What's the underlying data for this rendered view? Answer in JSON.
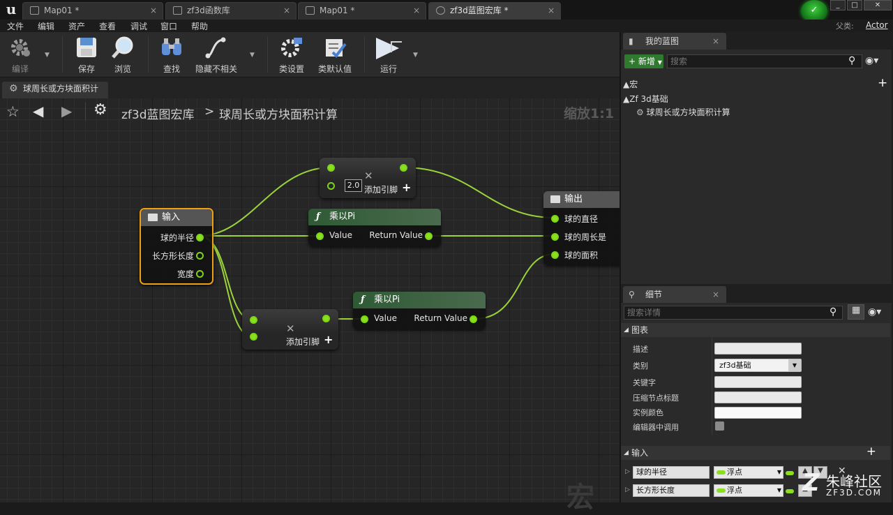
{
  "title_tabs": [
    {
      "label": "Map01 *"
    },
    {
      "label": "zf3d函数库"
    },
    {
      "label": "Map01 *"
    },
    {
      "label": "zf3d蓝图宏库 *"
    }
  ],
  "menu": [
    "文件",
    "编辑",
    "资产",
    "查看",
    "调试",
    "窗口",
    "帮助"
  ],
  "parent_class": {
    "label": "父类:",
    "value": "Actor"
  },
  "toolbar": {
    "compile": "编译",
    "save": "保存",
    "browse": "浏览",
    "find": "查找",
    "hide_unrelated": "隐藏不相关",
    "class_settings": "类设置",
    "class_defaults": "类默认值",
    "run": "运行"
  },
  "graph_tab": {
    "label": "球周长或方块面积计"
  },
  "breadcrumb": {
    "library": "zf3d蓝图宏库",
    "separator": ">",
    "current": "球周长或方块面积计算"
  },
  "zoom": "缩放1:1",
  "graph_watermark": "宏",
  "nodes": {
    "input": {
      "title": "输入",
      "pins": [
        "球的半径",
        "长方形长度",
        "宽度"
      ]
    },
    "mult_top": {
      "value": "2.0",
      "add_pin": "添加引脚"
    },
    "pi_top": {
      "title": "乘以Pi",
      "in": "Value",
      "out": "Return Value"
    },
    "mult_bottom": {
      "add_pin": "添加引脚"
    },
    "pi_bottom": {
      "title": "乘以Pi",
      "in": "Value",
      "out": "Return Value"
    },
    "output": {
      "title": "输出",
      "pins": [
        "球的直径",
        "球的周长是",
        "球的面积"
      ]
    }
  },
  "my_blueprint": {
    "tab": "我的蓝图",
    "add_button": "新增",
    "search_placeholder": "搜索",
    "section": "宏",
    "category": "Zf 3d基础",
    "item": "球周长或方块面积计算"
  },
  "details": {
    "tab": "细节",
    "search_placeholder": "搜索详情",
    "graph_section": "图表",
    "props": {
      "description": "描述",
      "category": "类别",
      "category_value": "zf3d基础",
      "keywords": "关键字",
      "compact_title": "压缩节点标题",
      "instance_color": "实例颜色",
      "call_in_editor": "编辑器中调用"
    },
    "inputs_section": "输入",
    "inputs": [
      {
        "name": "球的半径",
        "type": "浮点"
      },
      {
        "name": "长方形长度",
        "type": "浮点"
      }
    ]
  },
  "site_watermark": {
    "brand": "朱峰社区",
    "url": "ZF3D.COM"
  },
  "colors": {
    "pin": "#8be01e",
    "wire": "#9bd33a",
    "selected": "#f0a010",
    "function_head": "#2f5a34",
    "macro_head": "#5a5a5a"
  }
}
